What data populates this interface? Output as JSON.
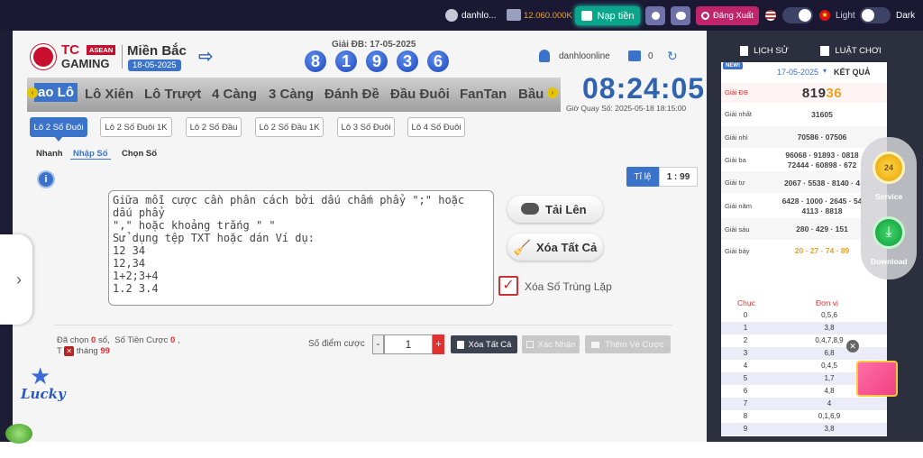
{
  "topbar": {
    "username": "danhlo...",
    "balance": "12.060.000K",
    "deposit": "Nạp tiền",
    "logout": "Đăng Xuất",
    "light": "Light",
    "dark": "Dark"
  },
  "header": {
    "brand_tc": "TC",
    "brand_asean": "ASEAN",
    "brand_gaming": "GAMING",
    "region": "Miền Bắc",
    "region_date": "18-05-2025",
    "prize_label": "Giải ĐB: 17-05-2025",
    "prize_digits": [
      "8",
      "1",
      "9",
      "3",
      "6"
    ],
    "user": "danhloonline",
    "wallet_count": "0",
    "clock": "08:24:05",
    "draw_time": "Giờ Quay Số: 2025-05-18 18:15:00"
  },
  "tabs": [
    "ao Lô",
    "Lô Xiên",
    "Lô Trượt",
    "4 Càng",
    "3 Càng",
    "Đánh Đề",
    "Đầu Đuôi",
    "FanTan",
    "Bầu"
  ],
  "subtabs": [
    "Lô 2 Số Đuôi",
    "Lô 2 Số Đuôi 1K",
    "Lô 2 Số Đầu",
    "Lô 2 Số Đầu 1K",
    "Lô 3 Số Đuôi",
    "Lô 4 Số Đuôi"
  ],
  "modes": [
    "Nhanh",
    "Nhập Số",
    "Chọn Số"
  ],
  "odds": {
    "label": "Tỉ lệ",
    "value": "1 : 99"
  },
  "textarea_text": "Giữa mỗi cược cần phân cách bởi dấu chấm phẩy \";\" hoặc dấu phẩy\n\",\" hoặc khoảng trắng \" \"\nSử dụng tệp TXT hoặc dán Ví dụ:\n12 34\n12,34\n1+2;3+4\n1.2 3.4",
  "actions": {
    "upload": "Tải Lên",
    "clear_all": "Xóa Tất Cả",
    "remove_dup": "Xóa Số Trùng Lặp"
  },
  "summary": {
    "chosen_prefix": "Đã chọn",
    "chosen_value": "0",
    "chosen_suffix": "số,",
    "bet_prefix": "Số Tiền Cược",
    "bet_value": "0",
    ",": ",",
    "win_prefix": "T",
    "win_mid": "tháng",
    "win_value": "99"
  },
  "bet_points": {
    "label": "Số điểm cược",
    "minus": "-",
    "value": "1",
    "plus": "+"
  },
  "bottom_buttons": {
    "clear": "Xóa Tất Cả",
    "confirm": "Xác Nhận",
    "add": "Thêm Vé Cược"
  },
  "right_panel": {
    "history": "LỊCH SỬ",
    "rules": "LUẬT CHƠI",
    "new_badge": "NEW!",
    "date": "17-05-2025",
    "result_title": "KẾT QUẢ",
    "results": [
      {
        "label": "Giải ĐB",
        "values": [
          "81936"
        ]
      },
      {
        "label": "Giải nhất",
        "values": [
          "31605"
        ]
      },
      {
        "label": "Giải nhì",
        "values": [
          "70586 · 07506"
        ]
      },
      {
        "label": "Giải ba",
        "values": [
          "96068 · 91893 · 0818",
          "72444 · 60898 · 672"
        ]
      },
      {
        "label": "Giải tư",
        "values": [
          "2067 · 5538 · 8140 · 4"
        ]
      },
      {
        "label": "Giải năm",
        "values": [
          "6428 · 1000 · 2645 · 54",
          "4113 · 8818"
        ]
      },
      {
        "label": "Giải sáu",
        "values": [
          "280 · 429 · 151"
        ]
      },
      {
        "label": "Giải bảy",
        "values": [
          "20 · 27 · 74 · 89"
        ]
      }
    ],
    "chuc_label": "Chục",
    "donvi_label": "Đơn vị",
    "chuc_rows": [
      {
        "chuc": "0",
        "donvi": "0,5,6"
      },
      {
        "chuc": "1",
        "donvi": "3,8"
      },
      {
        "chuc": "2",
        "donvi": "0,4,7,8,9"
      },
      {
        "chuc": "3",
        "donvi": "6,8"
      },
      {
        "chuc": "4",
        "donvi": "0,4,5"
      },
      {
        "chuc": "5",
        "donvi": "1,7"
      },
      {
        "chuc": "6",
        "donvi": "4,8"
      },
      {
        "chuc": "7",
        "donvi": "4"
      },
      {
        "chuc": "8",
        "donvi": "0,1,6,9"
      },
      {
        "chuc": "9",
        "donvi": "3,8"
      }
    ]
  },
  "floating": {
    "service": "Service",
    "download": "Download"
  },
  "colors": {
    "topbar": "#1a1833",
    "accent_blue": "#3a73c9",
    "prize_orange": "#f0a020",
    "red": "#e03030"
  }
}
